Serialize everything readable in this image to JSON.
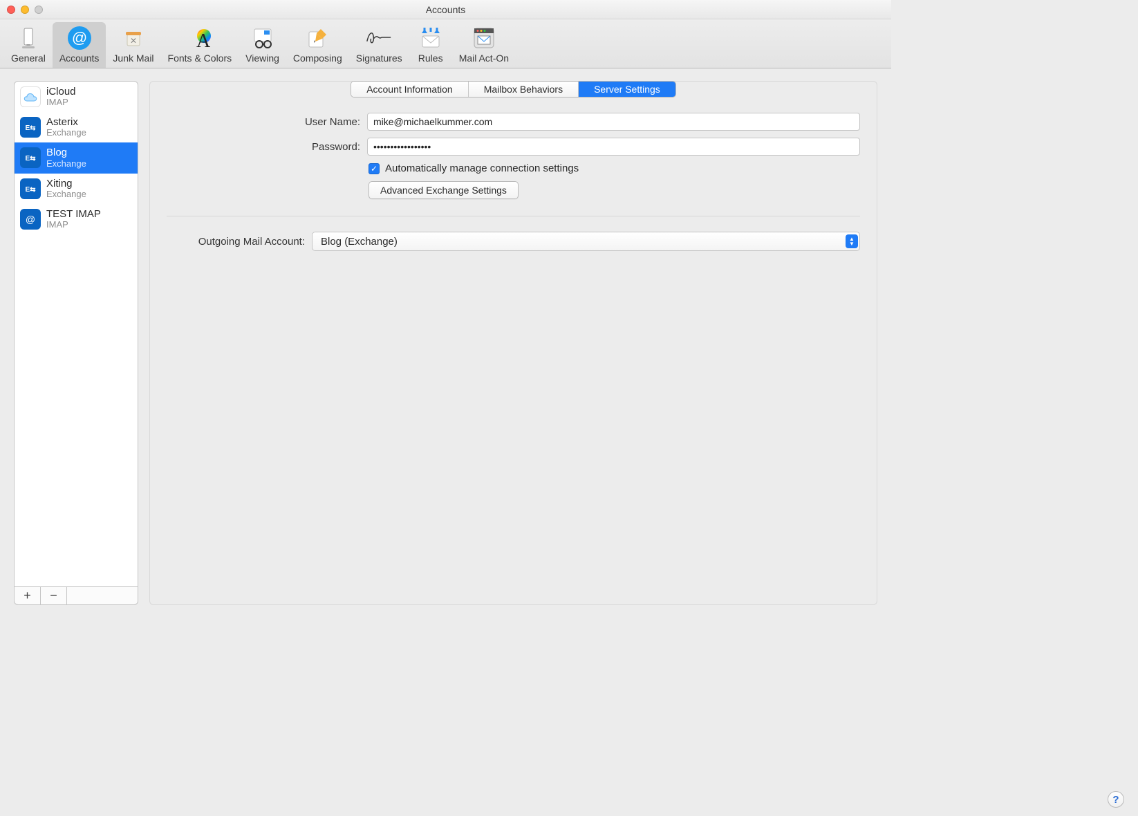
{
  "window": {
    "title": "Accounts"
  },
  "toolbar": {
    "items": [
      {
        "label": "General"
      },
      {
        "label": "Accounts"
      },
      {
        "label": "Junk Mail"
      },
      {
        "label": "Fonts & Colors"
      },
      {
        "label": "Viewing"
      },
      {
        "label": "Composing"
      },
      {
        "label": "Signatures"
      },
      {
        "label": "Rules"
      },
      {
        "label": "Mail Act-On"
      }
    ],
    "selected_index": 1
  },
  "accounts": {
    "items": [
      {
        "name": "iCloud",
        "subtitle": "IMAP",
        "kind": "cloud"
      },
      {
        "name": "Asterix",
        "subtitle": "Exchange",
        "kind": "exchange"
      },
      {
        "name": "Blog",
        "subtitle": "Exchange",
        "kind": "exchange"
      },
      {
        "name": "Xiting",
        "subtitle": "Exchange",
        "kind": "exchange"
      },
      {
        "name": "TEST IMAP",
        "subtitle": "IMAP",
        "kind": "imap"
      }
    ],
    "selected_index": 2
  },
  "tabs": {
    "items": [
      {
        "label": "Account Information"
      },
      {
        "label": "Mailbox Behaviors"
      },
      {
        "label": "Server Settings"
      }
    ],
    "selected_index": 2
  },
  "form": {
    "username_label": "User Name:",
    "username_value": "mike@michaelkummer.com",
    "password_label": "Password:",
    "password_value": "•••••••••••••••••",
    "auto_manage_label": "Automatically manage connection settings",
    "auto_manage_checked": true,
    "advanced_button": "Advanced Exchange Settings",
    "outgoing_label": "Outgoing Mail Account:",
    "outgoing_value": "Blog (Exchange)"
  },
  "footer": {
    "add": "+",
    "remove": "−"
  },
  "help_label": "?",
  "colors": {
    "accent": "#1f7bf6"
  }
}
